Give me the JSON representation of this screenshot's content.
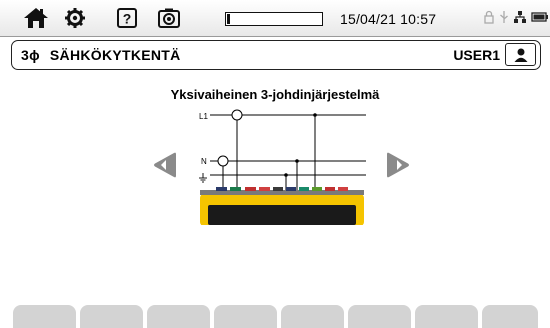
{
  "statusbar": {
    "datetime": "15/04/21 10:57",
    "progress_fraction": 0.03,
    "icons": [
      "home-icon",
      "gear-icon",
      "help-icon",
      "camera-icon",
      "lock-icon",
      "usb-icon",
      "network-icon",
      "battery-icon"
    ]
  },
  "header": {
    "phase_label": "3ϕ",
    "title": "SÄHKÖKYTKENTÄ",
    "user_label": "USER1"
  },
  "main": {
    "subtitle": "Yksivaiheinen 3-johdinjärjestelmä",
    "wire_labels": {
      "l1": "L1",
      "n": "N"
    }
  },
  "fkeys": {
    "count": 8
  },
  "colors": {
    "device_yellow": "#f5c400",
    "arrow_gray": "#8a8a8a",
    "fkey_gray": "#d3d3d3"
  }
}
